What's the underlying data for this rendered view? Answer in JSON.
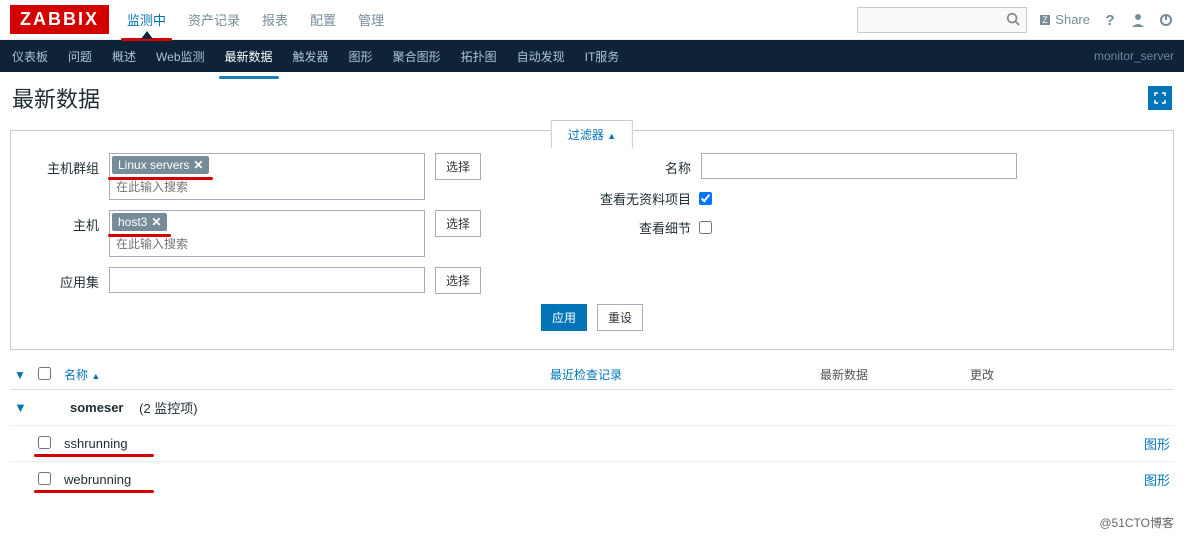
{
  "brand": "ZABBIX",
  "topmenu": {
    "items": [
      "监测中",
      "资产记录",
      "报表",
      "配置",
      "管理"
    ],
    "active_index": 0
  },
  "topbar": {
    "share": "Share",
    "search_placeholder": ""
  },
  "navbar": {
    "items": [
      "仪表板",
      "问题",
      "概述",
      "Web监测",
      "最新数据",
      "触发器",
      "图形",
      "聚合图形",
      "拓扑图",
      "自动发现",
      "IT服务"
    ],
    "active_index": 4,
    "right_text": "monitor_server"
  },
  "page": {
    "title": "最新数据"
  },
  "filter": {
    "tab_label": "过滤器",
    "labels": {
      "hostgroup": "主机群组",
      "host": "主机",
      "application": "应用集",
      "select": "选择",
      "name": "名称",
      "show_no_data": "查看无资料项目",
      "show_details": "查看细节",
      "apply": "应用",
      "reset": "重设"
    },
    "hostgroup": {
      "tags": [
        "Linux servers"
      ],
      "placeholder": "在此输入搜索"
    },
    "host": {
      "tags": [
        "host3"
      ],
      "placeholder": "在此输入搜索"
    },
    "application": {
      "value": ""
    },
    "name": {
      "value": ""
    },
    "show_no_data": true,
    "show_details": false
  },
  "table": {
    "headers": {
      "name": "名称",
      "last_check": "最近检查记录",
      "last_data": "最新数据",
      "change": "更改",
      "graph": "图形"
    },
    "group": {
      "name": "someser",
      "count_label": "(2 监控项)"
    },
    "items": [
      {
        "name": "sshrunning"
      },
      {
        "name": "webrunning"
      }
    ]
  },
  "watermark": "@51CTO博客"
}
